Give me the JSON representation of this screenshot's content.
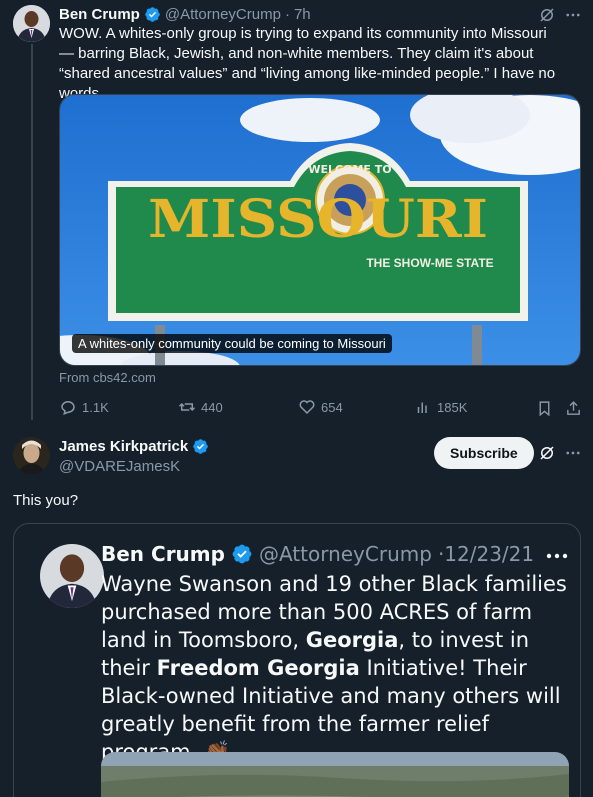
{
  "post": {
    "name": "Ben Crump",
    "handle": "@AttorneyCrump",
    "sep": "·",
    "time": "7h",
    "text": "WOW. A whites-only group is trying to expand its community into Missouri — barring Black, Jewish, and non-white members. They claim it's about “shared ancestral values” and “living among like-minded people.” I have no words.",
    "card": {
      "caption": "A whites-only community could be coming to Missouri",
      "source": "From cbs42.com",
      "sign": {
        "welcome": "WELCOME TO",
        "state": "MISSOURI",
        "tagline": "THE SHOW-ME STATE"
      }
    },
    "stats": {
      "replies": "1.1K",
      "reposts": "440",
      "likes": "654",
      "views": "185K"
    }
  },
  "reply": {
    "name": "James Kirkpatrick",
    "handle": "@VDAREJamesK",
    "subscribe_label": "Subscribe",
    "text": "This you?"
  },
  "quote": {
    "name": "Ben Crump",
    "handle": "@AttorneyCrump",
    "date": "·12/23/21",
    "segments": [
      {
        "t": "Wayne Swanson and 19 other Black families purchased more than 500 ACRES of farm land in Toomsboro, ",
        "b": false
      },
      {
        "t": "Georgia",
        "b": true
      },
      {
        "t": ", to invest in their ",
        "b": false
      },
      {
        "t": "Freedom Georgia",
        "b": true
      },
      {
        "t": " Initiative! Their Black-owned Initiative and many others will greatly benefit from the farmer relief program. 👏🏾",
        "b": false
      }
    ]
  },
  "colors": {
    "background": "#15202b",
    "verified": "#1d9bf0",
    "muted": "#8b98a5",
    "sign_green": "#1f8a4c",
    "sign_gold": "#e7b52b"
  }
}
